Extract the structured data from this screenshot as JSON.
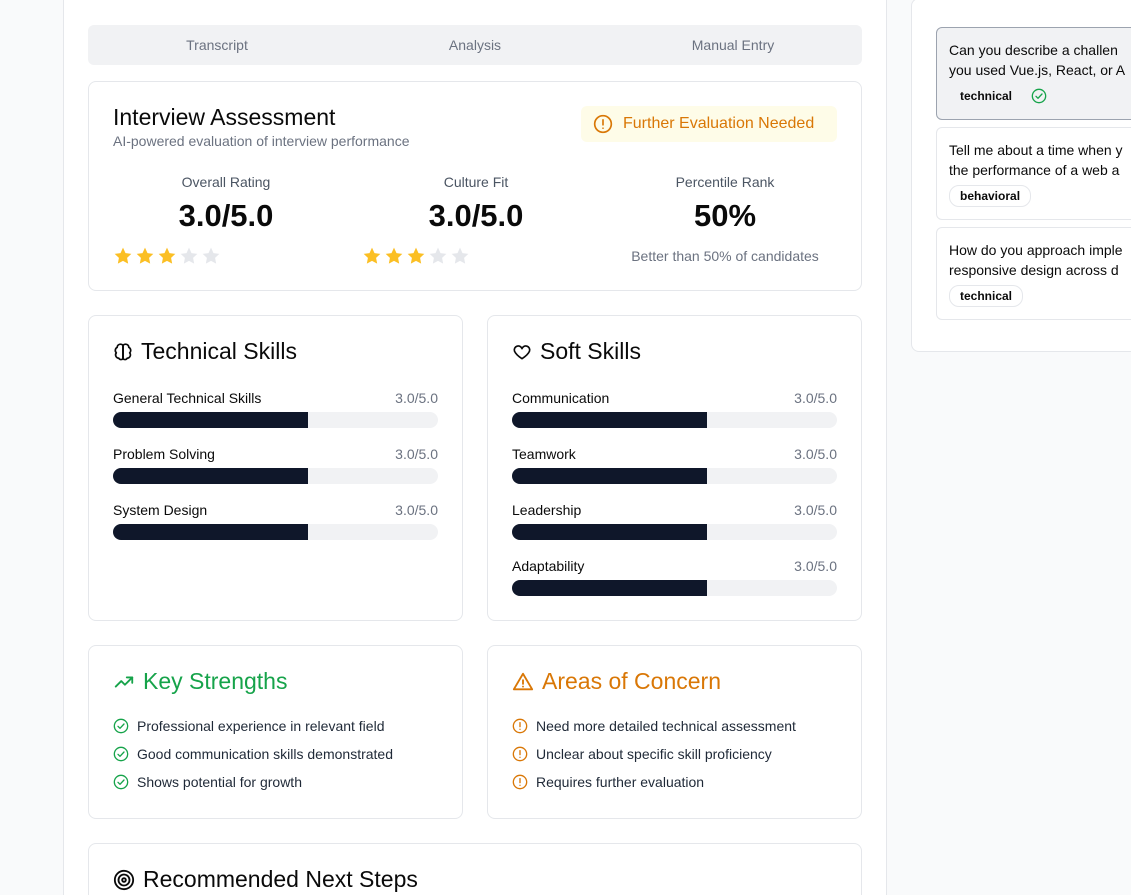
{
  "tabs": [
    "Transcript",
    "Analysis",
    "Manual Entry"
  ],
  "assessment": {
    "title": "Interview Assessment",
    "subtitle": "AI-powered evaluation of interview performance",
    "badge": "Further Evaluation Needed",
    "metrics": [
      {
        "label": "Overall Rating",
        "value": "3.0/5.0",
        "stars": 3,
        "max_stars": 5
      },
      {
        "label": "Culture Fit",
        "value": "3.0/5.0",
        "stars": 3,
        "max_stars": 5
      },
      {
        "label": "Percentile Rank",
        "value": "50%",
        "note": "Better than 50% of candidates"
      }
    ]
  },
  "technical": {
    "title": "Technical Skills",
    "skills": [
      {
        "name": "General Technical Skills",
        "score": "3.0/5.0",
        "level": 0.6
      },
      {
        "name": "Problem Solving",
        "score": "3.0/5.0",
        "level": 0.6
      },
      {
        "name": "System Design",
        "score": "3.0/5.0",
        "level": 0.6
      }
    ]
  },
  "soft": {
    "title": "Soft Skills",
    "skills": [
      {
        "name": "Communication",
        "score": "3.0/5.0",
        "level": 0.6
      },
      {
        "name": "Teamwork",
        "score": "3.0/5.0",
        "level": 0.6
      },
      {
        "name": "Leadership",
        "score": "3.0/5.0",
        "level": 0.6
      },
      {
        "name": "Adaptability",
        "score": "3.0/5.0",
        "level": 0.6
      }
    ]
  },
  "strengths": {
    "title": "Key Strengths",
    "items": [
      "Professional experience in relevant field",
      "Good communication skills demonstrated",
      "Shows potential for growth"
    ]
  },
  "concerns": {
    "title": "Areas of Concern",
    "items": [
      "Need more detailed technical assessment",
      "Unclear about specific skill proficiency",
      "Requires further evaluation"
    ]
  },
  "next_steps": {
    "title": "Recommended Next Steps"
  },
  "questions": [
    {
      "line1": "Can you describe a challen",
      "line2": "you used Vue.js, React, or A",
      "tag": "technical",
      "answered": true
    },
    {
      "line1": "Tell me about a time when y",
      "line2": "the performance of a web a",
      "tag": "behavioral",
      "answered": false
    },
    {
      "line1": "How do you approach imple",
      "line2": "responsive design across d",
      "tag": "technical",
      "answered": false
    }
  ],
  "colors": {
    "accent_dark": "#0f172a",
    "star_filled": "#fbbf24",
    "star_empty": "#e5e7eb",
    "success": "#16a34a",
    "warning": "#d97706",
    "badge_bg": "#fefce8"
  }
}
